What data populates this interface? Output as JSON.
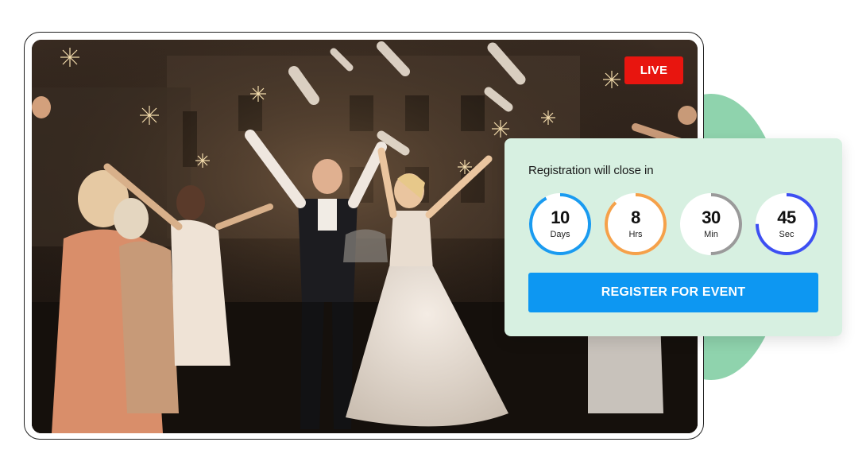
{
  "video": {
    "live_label": "LIVE",
    "live_color": "#e8150f"
  },
  "registration": {
    "title": "Registration will close in",
    "countdown": [
      {
        "value": "10",
        "unit": "Days",
        "color": "#1a9bf0",
        "progress": 0.92
      },
      {
        "value": "8",
        "unit": "Hrs",
        "color": "#f5a14a",
        "progress": 0.88
      },
      {
        "value": "30",
        "unit": "Min",
        "color": "#9a9a9a",
        "progress": 0.5
      },
      {
        "value": "45",
        "unit": "Sec",
        "color": "#3d4ff2",
        "progress": 0.75
      }
    ],
    "button_label": "REGISTER FOR EVENT",
    "button_color": "#0d97f2"
  }
}
